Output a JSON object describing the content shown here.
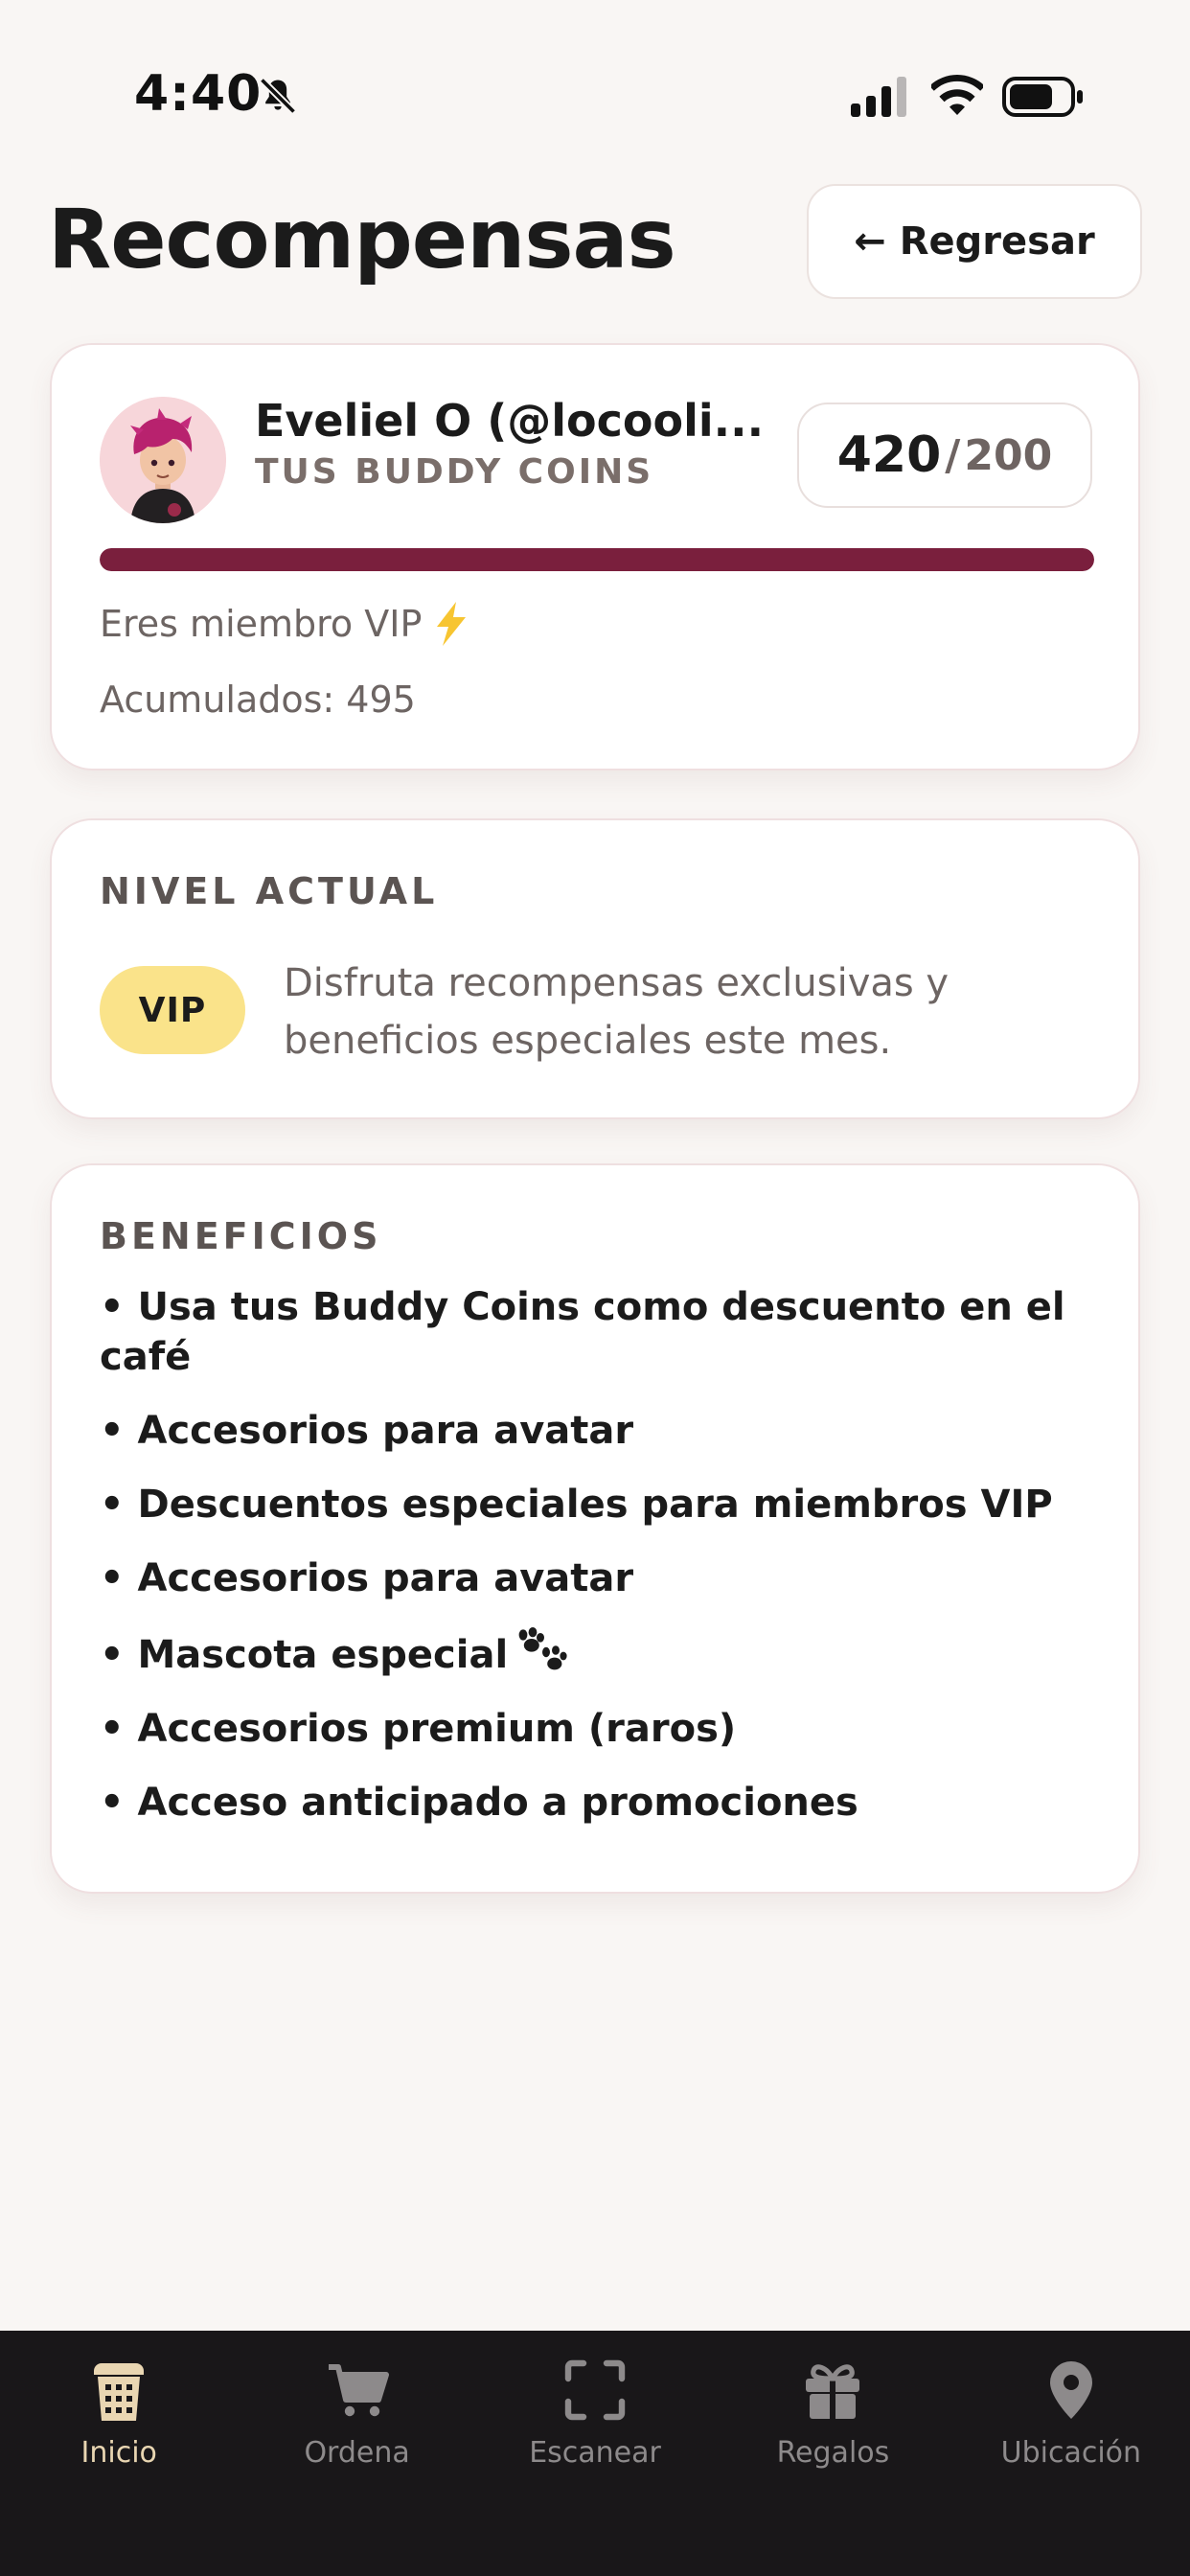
{
  "status_bar": {
    "time": "4:40"
  },
  "header": {
    "title": "Recompensas",
    "back_label": "← Regresar"
  },
  "profile": {
    "name": "Eveliel O (@locooli...",
    "coins_label": "TUS BUDDY COINS",
    "coins_current": "420",
    "coins_separator": "/",
    "coins_goal": "200",
    "progress_fraction": 1.0,
    "vip_note": "Eres miembro VIP",
    "accumulated": "Acumulados: 495"
  },
  "level": {
    "section_label": "NIVEL ACTUAL",
    "badge": "VIP",
    "description": "Disfruta recompensas exclusivas y beneficios especiales este mes."
  },
  "benefits": {
    "section_label": "BENEFICIOS",
    "items": [
      "• Usa tus Buddy Coins como descuento en el café",
      "• Accesorios para avatar",
      "• Descuentos especiales para miembros VIP",
      "• Accesorios para avatar",
      "• Mascota especial",
      "• Accesorios premium (raros)",
      "• Acceso anticipado a promociones"
    ]
  },
  "tabs": [
    {
      "label": "Inicio",
      "icon": "coffee-cup-icon",
      "active": true
    },
    {
      "label": "Ordena",
      "icon": "cart-icon",
      "active": false
    },
    {
      "label": "Escanear",
      "icon": "scan-icon",
      "active": false
    },
    {
      "label": "Regalos",
      "icon": "gift-icon",
      "active": false
    },
    {
      "label": "Ubicación",
      "icon": "location-pin-icon",
      "active": false
    }
  ],
  "colors": {
    "accent": "#7a1f3d",
    "vip_badge": "#fae38a",
    "tab_bar": "#191719",
    "tab_active": "#e9d6b2"
  }
}
